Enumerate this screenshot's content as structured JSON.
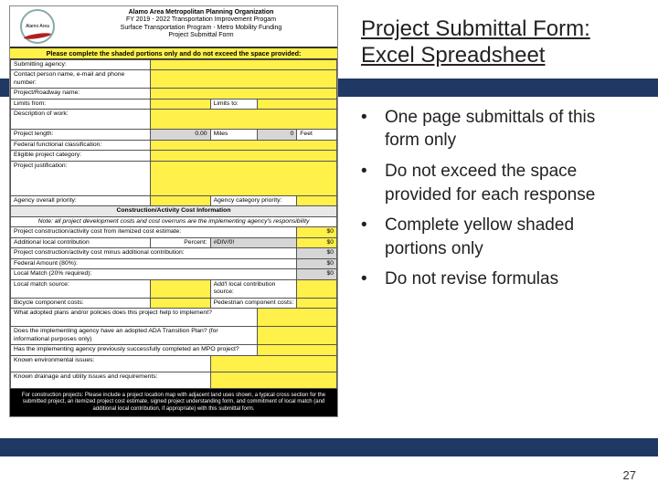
{
  "slide": {
    "title": "Project Submittal Form: Excel Spreadsheet",
    "bullets": [
      "One page submittals of this form only",
      "Do not exceed the space provided for each response",
      "Complete yellow shaded portions only",
      "Do not revise formulas"
    ],
    "page_number": "27"
  },
  "form": {
    "logo_text": "Alamo Area",
    "header_lines": [
      "Alamo Area Metropolitan Planning Organization",
      "FY 2019 - 2022 Transportation Improvement Progam",
      "Surface Transportation Program - Metro Mobility Funding",
      "Project Submittal Form"
    ],
    "instruction": "Please complete the shaded portions only and do not exceed the space provided:",
    "rows": {
      "submitting_agency": "Submitting agency:",
      "contact": "Contact person name, e-mail and phone number:",
      "project_roadway": "Project/Roadway name:",
      "limits_from": "Limits from:",
      "limits_to": "Limits to:",
      "description": "Description of work:",
      "project_length": "Project length:",
      "length_val": "0.00",
      "miles": "Miles",
      "zero": "0",
      "feet": "Feet",
      "fed_class": "Federal functional classification:",
      "eligible_cat": "Eligible project category:",
      "justification": "Project justification:",
      "overall_priority": "Agency overall priority:",
      "category_priority": "Agency category priority:"
    },
    "cost_section": {
      "header": "Construction/Activity Cost Information",
      "note": "Note: all project development costs and cost overruns are the implementing agency's responsibility",
      "r1": "Project construction/activity cost from itemized cost estimate:",
      "r2a": "Additional local contribution",
      "r2b": "Percent:",
      "r2c": "#DIV/0!",
      "r3": "Project construction/activity cost minus additional contribution:",
      "r4": "Federal Amount (80%):",
      "r5": "Local Match (20% required):",
      "zero_dollar": "$0",
      "match_src": "Local match source:",
      "addl_src": "Add'l local contribution source:",
      "bike": "Bicycle component costs:",
      "ped": "Pedestrian component costs:"
    },
    "questions": {
      "q1": "What adopted plans and/or policies does this project help to implement?",
      "q2": "Does the implementing agency have an adopted ADA Transition Plan? (for informational purposes only)",
      "q3": "Has the implementing agency previously successfully completed an MPO project?",
      "q4": "Known environmental issues:",
      "q5": "Known drainage and utility issues and requirements:"
    },
    "footer": "For construction projects: Please include a project location map with adjacent land uses shown, a typical cross section for the submitted project, an itemized project cost estimate, signed project understanding form, and commitment of local match (and additional local contribution, if appropriate) with this submittal form."
  }
}
